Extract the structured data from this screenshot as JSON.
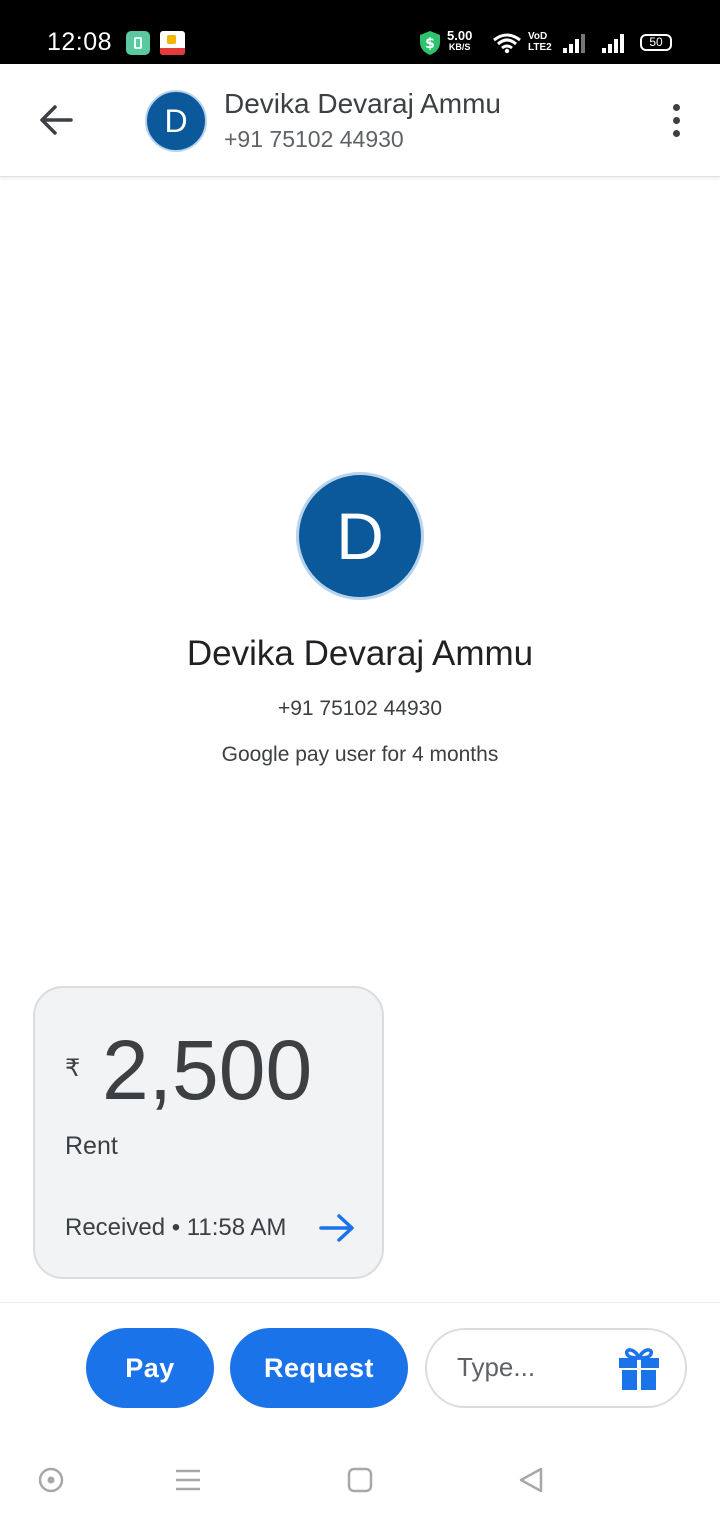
{
  "status_bar": {
    "time": "12:08",
    "speed_value": "5.00",
    "speed_unit": "KB/S",
    "volte_line1": "VoD",
    "volte_line2": "LTE2",
    "battery": "50"
  },
  "header": {
    "avatar_letter": "D",
    "name": "Devika Devaraj Ammu",
    "phone": "+91 75102 44930"
  },
  "profile": {
    "avatar_letter": "D",
    "name": "Devika Devaraj Ammu",
    "phone": "+91 75102 44930",
    "member_since": "Google pay user for 4 months"
  },
  "transaction": {
    "currency_symbol": "₹",
    "amount": "2,500",
    "memo": "Rent",
    "status": "Received • 11:58 AM"
  },
  "actions": {
    "pay_label": "Pay",
    "request_label": "Request",
    "message_placeholder": "Type..."
  },
  "icons": {
    "back": "arrow-left",
    "more": "more-vert",
    "card_arrow": "arrow-right",
    "gift": "gift",
    "nav_home": "circle-dot",
    "nav_recent": "menu-lines",
    "nav_overview": "rounded-square",
    "nav_back": "triangle-left"
  },
  "colors": {
    "accent": "#1a73e8",
    "avatar_bg": "#0b589b",
    "card_bg": "#f1f3f4"
  }
}
